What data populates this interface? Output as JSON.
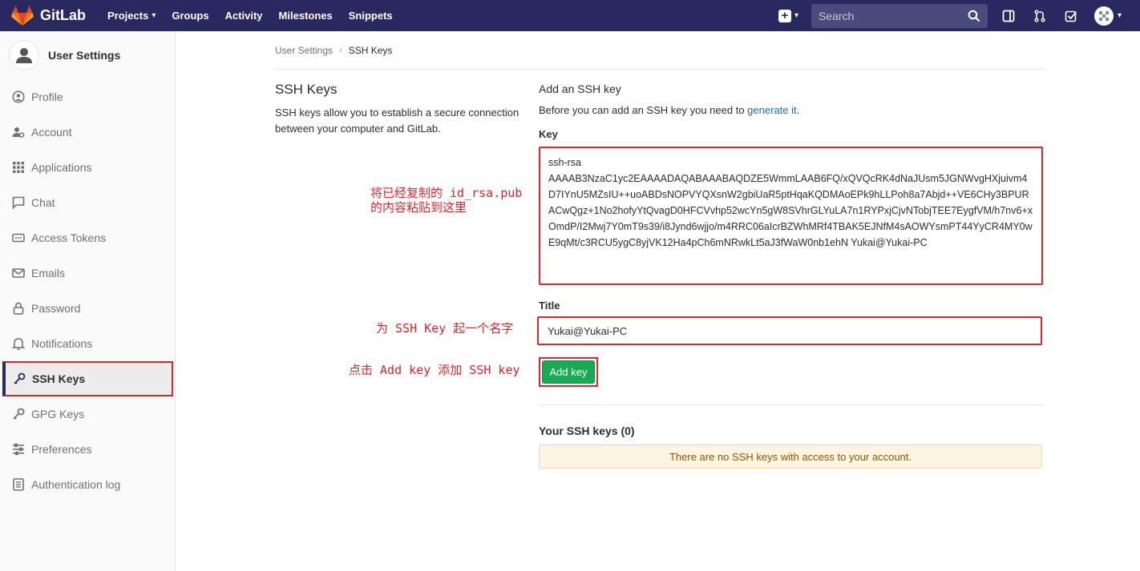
{
  "navbar": {
    "brand": "GitLab",
    "links": [
      {
        "label": "Projects",
        "dropdown": true
      },
      {
        "label": "Groups"
      },
      {
        "label": "Activity"
      },
      {
        "label": "Milestones"
      },
      {
        "label": "Snippets"
      }
    ],
    "search_placeholder": "Search",
    "icons": [
      "plus-icon",
      "search-icon",
      "sidebar-toggle-icon",
      "merge-request-icon",
      "todo-check-icon",
      "avatar-icon"
    ],
    "bg_color": "#292961"
  },
  "sidebar": {
    "title": "User Settings",
    "items": [
      {
        "label": "Profile",
        "icon": "profile-icon"
      },
      {
        "label": "Account",
        "icon": "account-icon"
      },
      {
        "label": "Applications",
        "icon": "applications-icon"
      },
      {
        "label": "Chat",
        "icon": "chat-icon"
      },
      {
        "label": "Access Tokens",
        "icon": "token-icon"
      },
      {
        "label": "Emails",
        "icon": "email-icon"
      },
      {
        "label": "Password",
        "icon": "lock-icon"
      },
      {
        "label": "Notifications",
        "icon": "bell-icon"
      },
      {
        "label": "SSH Keys",
        "icon": "key-icon",
        "active": true
      },
      {
        "label": "GPG Keys",
        "icon": "key-icon"
      },
      {
        "label": "Preferences",
        "icon": "sliders-icon"
      },
      {
        "label": "Authentication log",
        "icon": "log-icon"
      }
    ]
  },
  "breadcrumb": {
    "parent": "User Settings",
    "current": "SSH Keys"
  },
  "section": {
    "title": "SSH Keys",
    "description": "SSH keys allow you to establish a secure connection between your computer and GitLab."
  },
  "form": {
    "heading": "Add an SSH key",
    "hint_prefix": "Before you can add an SSH key you need to ",
    "hint_link": "generate it",
    "hint_suffix": ".",
    "key_label": "Key",
    "key_value": "ssh-rsa\nAAAAB3NzaC1yc2EAAAADAQABAAABAQDZE5WmmLAAB6FQ/xQVQcRK4dNaJUsm5JGNWvgHXjuivm4D7IYnU5MZsIU++uoABDsNOPVYQXsnW2gbiUaR5ptHqaKQDMAoEPk9hLLPoh8a7Abjd++VE6CHy3BPURACwQgz+1No2hofyYtQvagD0HFCVvhp52wcYn5gW8SVhrGLYuLA7n1RYPxjCjvNTobjTEE7EygfVM/h7nv6+xOmdP/I2Mwj7Y0mT9s39/i8Jynd6wjjo/m4RRC06aIcrBZWhMRf4TBAK5EJNfM4sAOWYsmPT44YyCR4MY0wE9qMt/c3RCU5ygC8yjVK12Ha4pCh6mNRwkLt5aJ3fWaW0nb1ehN Yukai@Yukai-PC",
    "title_label": "Title",
    "title_value": "Yukai@Yukai-PC",
    "submit_label": "Add key"
  },
  "keys_list": {
    "heading": "Your SSH keys (0)",
    "empty_message": "There are no SSH keys with access to your account."
  },
  "annotations": {
    "key_note_line1": "将已经复制的 id_rsa.pub",
    "key_note_line2": "的内容粘贴到这里",
    "title_note": "为 SSH Key 起一个名字",
    "button_note": "点击 Add key 添加 SSH key",
    "color": "#d9262b"
  }
}
